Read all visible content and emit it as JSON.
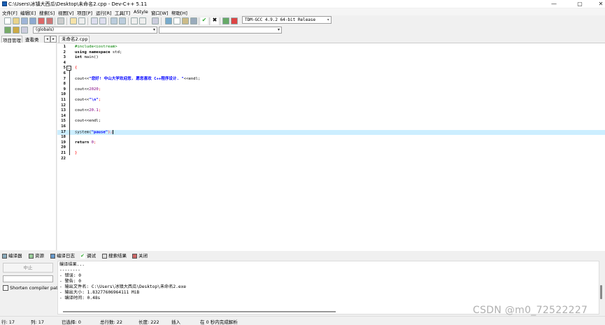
{
  "window": {
    "title": "C:\\Users\\冰镇大西瓜\\Desktop\\未命名2.cpp - Dev-C++ 5.11",
    "minimize": "—",
    "maximize": "▢",
    "close": "✕"
  },
  "menu": [
    "文件[F]",
    "编辑[E]",
    "搜索[S]",
    "视图[V]",
    "项目[P]",
    "运行[R]",
    "工具[T]",
    "AStyle",
    "窗口[W]",
    "帮助[H]"
  ],
  "toolbar": {
    "compiler": "TDM-GCC 4.9.2 64-bit Release",
    "scope": "(globals)",
    "function": ""
  },
  "left_tabs": {
    "project": "项目管理",
    "classes": "查看类",
    "prev": "◂",
    "next": "▸"
  },
  "editor": {
    "file_tab": "未命名2.cpp",
    "fold_marker": "−",
    "lines": [
      "1",
      "2",
      "3",
      "4",
      "5",
      "6",
      "7",
      "8",
      "9",
      "10",
      "11",
      "12",
      "13",
      "14",
      "15",
      "16",
      "17",
      "18",
      "19",
      "20",
      "21",
      "22"
    ],
    "code": {
      "l1": "#include<iostream>",
      "l2a": "using namespace",
      "l2b": " std;",
      "l3a": "int",
      "l3b": " main()",
      "l5": "{",
      "l7a": "cout<<",
      "l7b": "\"您好! 中山大学欢迎您, 愿您喜欢 C++程序设计. \"",
      "l7c": "<<endl;",
      "l9a": "cout<<",
      "l9b": "2020",
      "l9c": ";",
      "l11a": "cout<<",
      "l11b": "\"\\n\"",
      "l11c": ";",
      "l13a": "cout<<",
      "l13b": "20.1",
      "l13c": ";",
      "l15": "cout<<endl;",
      "l17a": "system(",
      "l17b": "\"pause\"",
      "l17c": ");",
      "l19a": "return",
      "l19b": " 0",
      "l19c": ";",
      "l21": "}"
    }
  },
  "bottom_tabs": [
    "编译器",
    "资源",
    "编译日志",
    "调试",
    "搜索结果",
    "关闭"
  ],
  "compile_panel": {
    "stop_label": "中止",
    "shorten_label": "Shorten compiler paths",
    "output": [
      "编译结果...",
      "--------",
      "- 错误: 0",
      "- 警告: 0",
      "- 输出文件名: C:\\Users\\冰镇大西瓜\\Desktop\\未命名2.exe",
      "- 输出大小: 1.83277606964111 MiB",
      "- 编译时间: 0.48s"
    ]
  },
  "status": {
    "row": "行:  17",
    "col": "列:  17",
    "selected": "已选择:  0",
    "total_lines": "总行数:  22",
    "length": "长度:  222",
    "mode": "插入",
    "parse": "在 0 秒内完成解析"
  },
  "watermark": "CSDN @m0_72522227",
  "colors": {
    "active_line": "#cceeff",
    "string": "#0000ff",
    "number": "#800080",
    "preprocessor": "#008000"
  }
}
